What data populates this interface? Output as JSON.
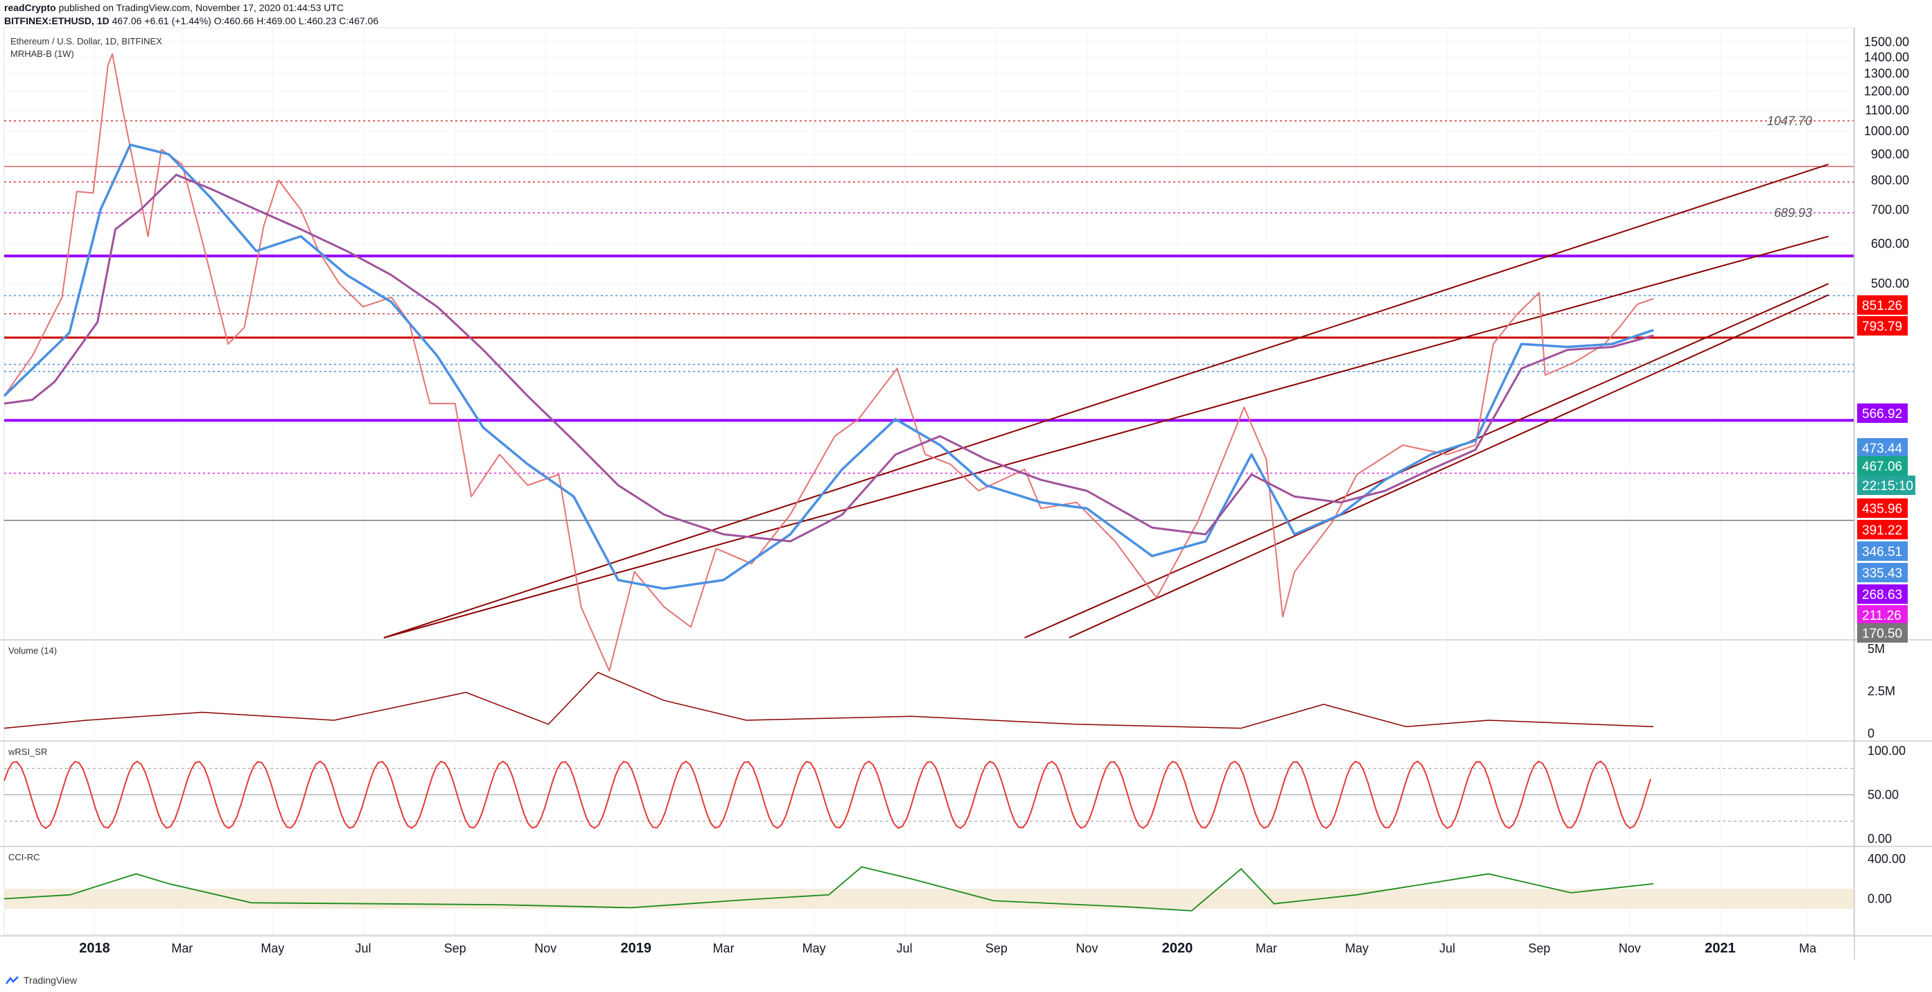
{
  "header": {
    "publisher_line": {
      "author": "readCrypto",
      "rest": " published on TradingView.com, November 17, 2020 01:44:53 UTC"
    },
    "quote_line": {
      "symbol": "BITFINEX:ETHUSD, 1D",
      "price": "467.06",
      "change": "+6.61 (+1.44%)",
      "ohlc": "O:460.66 H:469.00 L:460.23 C:467.06"
    }
  },
  "legend": {
    "title": "Ethereum / U.S. Dollar, 1D, BITFINEX",
    "indicator": "MRHAB-B (1W)",
    "volume": "Volume (14)",
    "wrsi": "wRSI_SR",
    "cci": "CCI-RC"
  },
  "footer": {
    "brand": "TradingView"
  },
  "colors": {
    "red": "#ff0000",
    "purple": "#9900ff",
    "blue": "#4a90e2",
    "green": "#17a589",
    "teal": "#26a69a",
    "magenta": "#e91ee9",
    "grey": "#777777",
    "darkred": "#8b0000"
  },
  "chart_data": {
    "type": "line",
    "x_axis": {
      "ticks": [
        "2018",
        "Mar",
        "May",
        "Jul",
        "Sep",
        "Nov",
        "2019",
        "Mar",
        "May",
        "Jul",
        "Sep",
        "Nov",
        "2020",
        "Mar",
        "May",
        "Jul",
        "Sep",
        "Nov",
        "2021",
        "Ma"
      ],
      "range": [
        "2017-11-01",
        "2021-04-01"
      ]
    },
    "price_axis": {
      "ticks": [
        "1500.00",
        "1400.00",
        "1300.00",
        "1200.00",
        "1100.00",
        "1000.00",
        "900.00",
        "800.00",
        "700.00",
        "600.00",
        "500.00"
      ],
      "ylim": [
        100,
        1600
      ],
      "scale": "log"
    },
    "series": [
      {
        "name": "ETHUSD",
        "points": [
          [
            "2017-11-01",
            300
          ],
          [
            "2017-11-20",
            360
          ],
          [
            "2017-12-10",
            470
          ],
          [
            "2017-12-20",
            760
          ],
          [
            "2017-12-31",
            755
          ],
          [
            "2018-01-10",
            1350
          ],
          [
            "2018-01-13",
            1420
          ],
          [
            "2018-01-20",
            1100
          ],
          [
            "2018-02-06",
            620
          ],
          [
            "2018-02-15",
            920
          ],
          [
            "2018-03-01",
            860
          ],
          [
            "2018-03-15",
            600
          ],
          [
            "2018-04-01",
            380
          ],
          [
            "2018-04-12",
            410
          ],
          [
            "2018-04-25",
            650
          ],
          [
            "2018-05-05",
            800
          ],
          [
            "2018-05-20",
            700
          ],
          [
            "2018-06-01",
            580
          ],
          [
            "2018-06-15",
            500
          ],
          [
            "2018-07-01",
            450
          ],
          [
            "2018-07-20",
            470
          ],
          [
            "2018-08-01",
            420
          ],
          [
            "2018-08-15",
            290
          ],
          [
            "2018-09-01",
            290
          ],
          [
            "2018-09-12",
            190
          ],
          [
            "2018-10-01",
            230
          ],
          [
            "2018-10-20",
            200
          ],
          [
            "2018-11-10",
            210
          ],
          [
            "2018-11-25",
            115
          ],
          [
            "2018-12-14",
            86
          ],
          [
            "2018-12-31",
            135
          ],
          [
            "2019-01-20",
            115
          ],
          [
            "2019-02-07",
            105
          ],
          [
            "2019-02-24",
            150
          ],
          [
            "2019-03-20",
            140
          ],
          [
            "2019-04-15",
            175
          ],
          [
            "2019-05-15",
            250
          ],
          [
            "2019-05-31",
            270
          ],
          [
            "2019-06-26",
            340
          ],
          [
            "2019-07-15",
            230
          ],
          [
            "2019-08-01",
            220
          ],
          [
            "2019-08-20",
            195
          ],
          [
            "2019-09-20",
            215
          ],
          [
            "2019-10-01",
            180
          ],
          [
            "2019-10-25",
            185
          ],
          [
            "2019-11-20",
            155
          ],
          [
            "2019-12-18",
            120
          ],
          [
            "2020-01-15",
            170
          ],
          [
            "2020-02-15",
            285
          ],
          [
            "2020-03-01",
            225
          ],
          [
            "2020-03-12",
            110
          ],
          [
            "2020-03-20",
            135
          ],
          [
            "2020-04-15",
            170
          ],
          [
            "2020-05-01",
            210
          ],
          [
            "2020-06-01",
            240
          ],
          [
            "2020-07-01",
            230
          ],
          [
            "2020-07-20",
            240
          ],
          [
            "2020-08-01",
            380
          ],
          [
            "2020-08-17",
            435
          ],
          [
            "2020-09-01",
            480
          ],
          [
            "2020-09-05",
            330
          ],
          [
            "2020-09-25",
            350
          ],
          [
            "2020-10-15",
            380
          ],
          [
            "2020-10-25",
            410
          ],
          [
            "2020-11-06",
            455
          ],
          [
            "2020-11-17",
            467
          ]
        ]
      },
      {
        "name": "ma",
        "points": [
          [
            "2017-11-01",
            300
          ],
          [
            "2017-12-15",
            400
          ],
          [
            "2018-01-05",
            700
          ],
          [
            "2018-01-25",
            940
          ],
          [
            "2018-02-20",
            900
          ],
          [
            "2018-03-20",
            740
          ],
          [
            "2018-04-20",
            580
          ],
          [
            "2018-05-20",
            620
          ],
          [
            "2018-06-20",
            520
          ],
          [
            "2018-07-20",
            460
          ],
          [
            "2018-08-20",
            360
          ],
          [
            "2018-09-20",
            260
          ],
          [
            "2018-10-20",
            220
          ],
          [
            "2018-11-20",
            190
          ],
          [
            "2018-12-20",
            130
          ],
          [
            "2019-01-20",
            125
          ],
          [
            "2019-03-01",
            130
          ],
          [
            "2019-04-15",
            160
          ],
          [
            "2019-05-20",
            215
          ],
          [
            "2019-06-25",
            270
          ],
          [
            "2019-07-25",
            240
          ],
          [
            "2019-08-25",
            200
          ],
          [
            "2019-10-01",
            185
          ],
          [
            "2019-11-01",
            180
          ],
          [
            "2019-12-15",
            145
          ],
          [
            "2020-01-20",
            155
          ],
          [
            "2020-02-20",
            230
          ],
          [
            "2020-03-20",
            160
          ],
          [
            "2020-04-20",
            175
          ],
          [
            "2020-05-20",
            205
          ],
          [
            "2020-06-20",
            230
          ],
          [
            "2020-07-20",
            245
          ],
          [
            "2020-08-20",
            380
          ],
          [
            "2020-09-20",
            375
          ],
          [
            "2020-10-20",
            380
          ],
          [
            "2020-11-17",
            405
          ]
        ]
      },
      {
        "name": "hline",
        "points": [
          [
            "2017-11-01",
            290
          ],
          [
            "2017-11-20",
            295
          ],
          [
            "2017-12-05",
            320
          ],
          [
            "2018-01-03",
            420
          ],
          [
            "2018-01-15",
            640
          ],
          [
            "2018-02-01",
            700
          ],
          [
            "2018-02-25",
            820
          ],
          [
            "2018-03-20",
            770
          ],
          [
            "2018-04-20",
            700
          ],
          [
            "2018-05-20",
            640
          ],
          [
            "2018-06-20",
            580
          ],
          [
            "2018-07-20",
            520
          ],
          [
            "2018-08-20",
            450
          ],
          [
            "2018-09-20",
            370
          ],
          [
            "2018-10-20",
            300
          ],
          [
            "2018-11-20",
            245
          ],
          [
            "2018-12-20",
            200
          ],
          [
            "2019-01-20",
            175
          ],
          [
            "2019-03-01",
            160
          ],
          [
            "2019-04-15",
            155
          ],
          [
            "2019-05-20",
            175
          ],
          [
            "2019-06-25",
            230
          ],
          [
            "2019-07-25",
            250
          ],
          [
            "2019-08-25",
            225
          ],
          [
            "2019-10-01",
            205
          ],
          [
            "2019-11-01",
            195
          ],
          [
            "2019-12-15",
            165
          ],
          [
            "2020-01-20",
            160
          ],
          [
            "2020-02-20",
            210
          ],
          [
            "2020-03-20",
            190
          ],
          [
            "2020-04-20",
            185
          ],
          [
            "2020-05-20",
            195
          ],
          [
            "2020-06-20",
            215
          ],
          [
            "2020-07-20",
            235
          ],
          [
            "2020-08-20",
            340
          ],
          [
            "2020-09-20",
            370
          ],
          [
            "2020-10-20",
            375
          ],
          [
            "2020-11-17",
            395
          ]
        ]
      }
    ],
    "trend_lines": [
      {
        "from": [
          "2018-07-15",
          100
        ],
        "to": [
          "2021-03-15",
          860
        ]
      },
      {
        "from": [
          "2018-07-15",
          100
        ],
        "to": [
          "2021-03-15",
          620
        ]
      },
      {
        "from": [
          "2019-09-20",
          100
        ],
        "to": [
          "2021-03-15",
          500
        ]
      },
      {
        "from": [
          "2019-10-20",
          100
        ],
        "to": [
          "2021-03-15",
          475
        ]
      }
    ],
    "horizontal_levels": [
      {
        "value": 1047.7,
        "style": "dotted",
        "color": "#cc3333",
        "label": "1047.70"
      },
      {
        "value": 851.26,
        "style": "solid",
        "color": "#e06666"
      },
      {
        "value": 793.79,
        "style": "dotted",
        "color": "#cc3333"
      },
      {
        "value": 689.93,
        "style": "dotted",
        "color": "#cc33cc",
        "label": "689.93"
      },
      {
        "value": 566.92,
        "style": "solid",
        "color": "#9900ff"
      },
      {
        "value": 473.44,
        "style": "dotted",
        "color": "#4a90e2"
      },
      {
        "value": 435.96,
        "style": "dotted",
        "color": "#cc3333"
      },
      {
        "value": 391.22,
        "style": "solid",
        "color": "#cc0000"
      },
      {
        "value": 346.51,
        "style": "dotted",
        "color": "#4a90e2"
      },
      {
        "value": 335.43,
        "style": "dotted",
        "color": "#4a90e2"
      },
      {
        "value": 268.63,
        "style": "solid",
        "color": "#9900ff"
      },
      {
        "value": 211.26,
        "style": "dotted",
        "color": "#e91ee9"
      },
      {
        "value": 170.5,
        "style": "solid",
        "color": "#777777"
      }
    ],
    "price_labels": [
      {
        "text": "851.26",
        "color": "#ff0000",
        "value": 851.26
      },
      {
        "text": "793.79",
        "color": "#ff0000",
        "value": 793.79
      },
      {
        "text": "566.92",
        "color": "#9900ff",
        "value": 566.92
      },
      {
        "text": "473.44",
        "color": "#4a90e2",
        "value": 473.44
      },
      {
        "text": "467.06",
        "color": "#17a589",
        "value": 467.06
      },
      {
        "text": "22:15:10",
        "color": "#26a69a",
        "value": 440
      },
      {
        "text": "435.96",
        "color": "#ff0000",
        "value": 435.96
      },
      {
        "text": "391.22",
        "color": "#ff0000",
        "value": 391.22
      },
      {
        "text": "346.51",
        "color": "#4a90e2",
        "value": 346.51
      },
      {
        "text": "335.43",
        "color": "#4a90e2",
        "value": 335.43
      },
      {
        "text": "268.63",
        "color": "#9900ff",
        "value": 268.63
      },
      {
        "text": "211.26",
        "color": "#e91ee9",
        "value": 211.26
      },
      {
        "text": "170.50",
        "color": "#777777",
        "value": 170.5
      }
    ],
    "volume_axis": {
      "ticks": [
        "5M",
        "2.5M",
        "0"
      ]
    },
    "rsi_axis": {
      "ticks": [
        "100.00",
        "50.00",
        "0.00"
      ]
    },
    "cci_axis": {
      "ticks": [
        "400.00",
        "0.00"
      ]
    }
  }
}
